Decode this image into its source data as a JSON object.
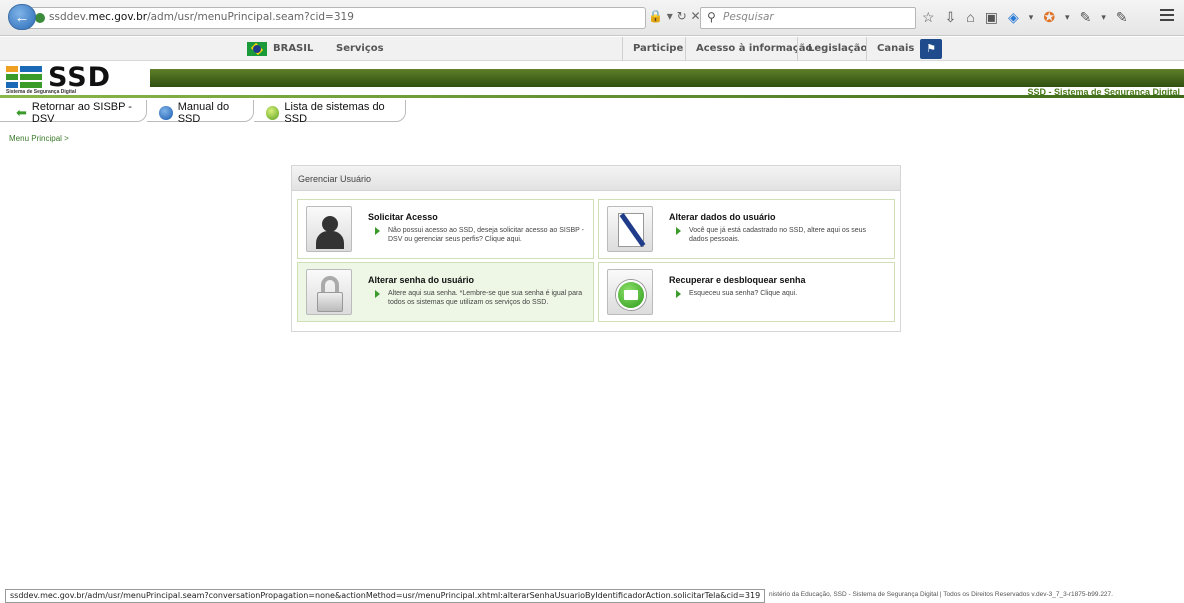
{
  "browser": {
    "url_prefix": "ssddev.",
    "url_domain": "mec.gov.br",
    "url_path": "/adm/usr/menuPrincipal.seam?cid=319",
    "search_placeholder": "Pesquisar"
  },
  "govbar": {
    "brasil": "BRASIL",
    "servicos": "Serviços",
    "links": [
      "Participe",
      "Acesso à informação",
      "Legislação",
      "Canais"
    ]
  },
  "header": {
    "logo_text": "SSD",
    "logo_sub": "Sistema de Segurança Digital",
    "system_title": "SSD - Sistema de Segurança Digital"
  },
  "nav": {
    "back_label": "Retornar ao SISBP - DSV",
    "manual_label": "Manual do SSD",
    "list_label": "Lista de sistemas do SSD"
  },
  "breadcrumb": "Menu Principal >",
  "panel": {
    "title": "Gerenciar Usuário",
    "cards": [
      {
        "title": "Solicitar Acesso",
        "desc": "Não possui acesso ao SSD, deseja solicitar acesso ao SISBP - DSV ou gerenciar seus perfis? Clique aqui."
      },
      {
        "title": "Alterar dados do usuário",
        "desc": "Você que já está cadastrado no SSD, altere aqui os seus dados pessoais."
      },
      {
        "title": "Alterar senha do usuário",
        "desc": "Altere aqui sua senha. *Lembre-se que sua senha é igual para todos os sistemas que utilizam os serviços do SSD."
      },
      {
        "title": "Recuperar e desbloquear senha",
        "desc": "Esqueceu sua senha? Clique aqui."
      }
    ]
  },
  "status": {
    "hover_url": "ssddev.mec.gov.br/adm/usr/menuPrincipal.seam?conversationPropagation=none&actionMethod=usr/menuPrincipal.xhtml:alterarSenhaUsuarioByIdentificadorAction.solicitarTela&cid=319",
    "footer": "nistério da Educação, SSD - Sistema de Segurança Digital | Todos os Direitos Reservados v.dev-3_7_3-r1875-b99.227."
  }
}
